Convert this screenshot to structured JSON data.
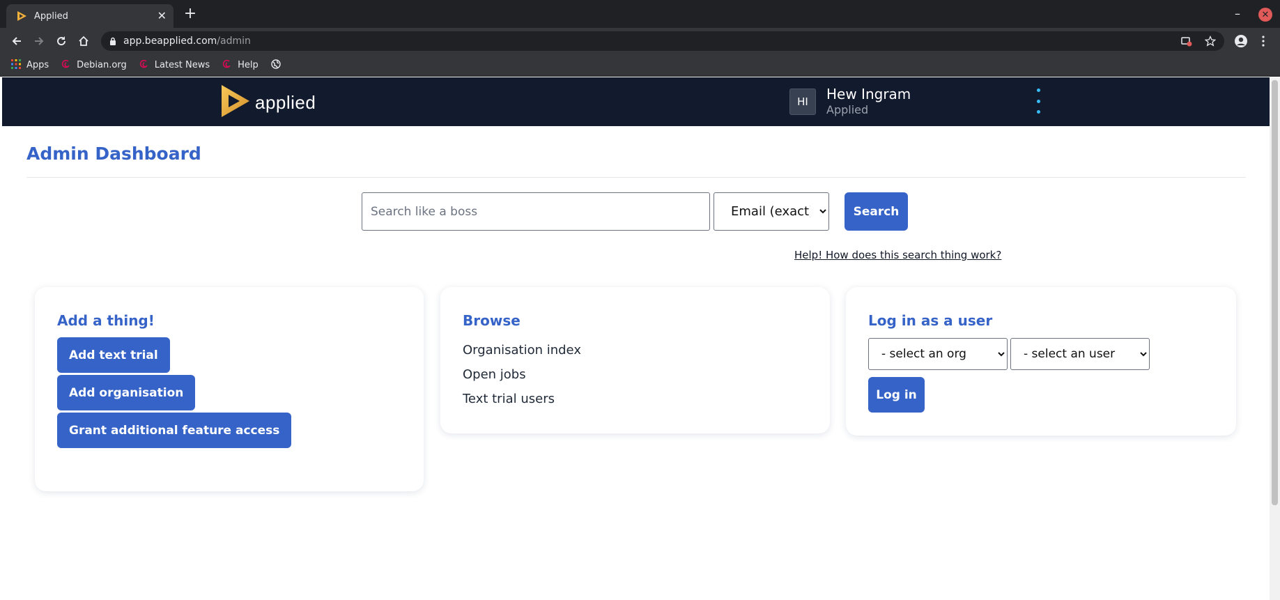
{
  "browser": {
    "tab_title": "Applied",
    "url_host": "app.beapplied.com",
    "url_path": "/admin",
    "bookmarks": [
      {
        "label": "Apps",
        "icon": "apps-grid-icon"
      },
      {
        "label": "Debian.org",
        "icon": "debian-swirl-icon"
      },
      {
        "label": "Latest News",
        "icon": "debian-swirl-icon"
      },
      {
        "label": "Help",
        "icon": "debian-swirl-icon"
      }
    ]
  },
  "header": {
    "logo_text": "applied",
    "avatar_initials": "HI",
    "user_name": "Hew Ingram",
    "user_org": "Applied",
    "brand_color": "#121a2e",
    "accent_color": "#3563c7"
  },
  "page": {
    "title": "Admin Dashboard"
  },
  "search": {
    "placeholder": "Search like a boss",
    "value": "",
    "mode_selected": "Email (exact)",
    "button_label": "Search",
    "help_link": "Help! How does this search thing work?"
  },
  "cards": {
    "add": {
      "title": "Add a thing!",
      "buttons": [
        "Add text trial",
        "Add organisation",
        "Grant additional feature access"
      ]
    },
    "browse": {
      "title": "Browse",
      "links": [
        "Organisation index",
        "Open jobs",
        "Text trial users"
      ]
    },
    "login": {
      "title": "Log in as a user",
      "org_select": "- select an org",
      "user_select": "- select an user",
      "button_label": "Log in"
    }
  }
}
